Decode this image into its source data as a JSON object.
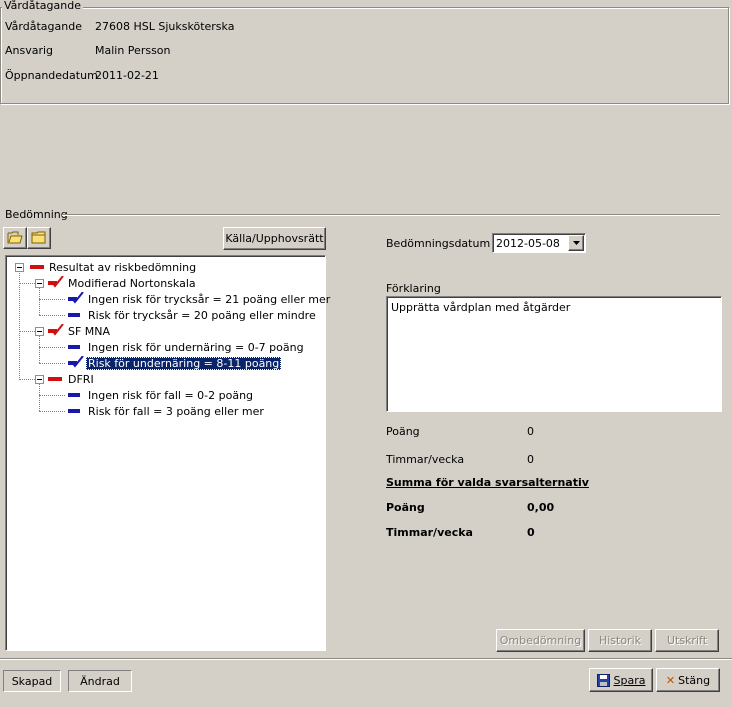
{
  "vardatagande_group": {
    "legend": "Vårdåtagande",
    "rows": [
      {
        "label": "Vårdåtagande",
        "value": "27608 HSL Sjuksköterska"
      },
      {
        "label": "Ansvarig",
        "value": "Malin Persson"
      },
      {
        "label": "Öppnandedatum",
        "value": "2011-02-21"
      }
    ]
  },
  "bedomning": {
    "legend": "Bedömning",
    "toolbar": {
      "open_icon": "folder-open-icon",
      "close_icon": "folder-closed-icon",
      "source_button": "Källa/Upphovsrätt"
    },
    "tree": {
      "root": "Resultat av riskbedömning",
      "groups": [
        {
          "label": "Modifierad Nortonskala",
          "icon": "red-check-icon",
          "items": [
            {
              "label": "Ingen risk för trycksår = 21 poäng eller mer",
              "icon": "blue-check-icon",
              "selected": false
            },
            {
              "label": "Risk för trycksår = 20 poäng eller mindre",
              "icon": "blue-bar-icon",
              "selected": false
            }
          ]
        },
        {
          "label": "SF MNA",
          "icon": "red-check-icon",
          "items": [
            {
              "label": "Ingen risk för undernäring = 0-7 poäng",
              "icon": "blue-bar-icon",
              "selected": false
            },
            {
              "label": "Risk för undernäring = 8-11 poäng",
              "icon": "blue-check-icon",
              "selected": true
            }
          ]
        },
        {
          "label": "DFRI",
          "icon": "red-bar-icon",
          "items": [
            {
              "label": "Ingen risk för fall = 0-2 poäng",
              "icon": "blue-bar-icon",
              "selected": false
            },
            {
              "label": "Risk för fall = 3 poäng eller mer",
              "icon": "blue-bar-icon",
              "selected": false
            }
          ]
        }
      ]
    },
    "date_label": "Bedömningsdatum",
    "date_value": "2012-05-08",
    "forklaring_label": "Förklaring",
    "forklaring_value": "Upprätta vårdplan med åtgärder",
    "poang_label": "Poäng",
    "poang_value": "0",
    "timmar_label": "Timmar/vecka",
    "timmar_value": "0",
    "summa_heading": "Summa för valda svarsalternativ",
    "summa_poang_label": "Poäng",
    "summa_poang_value": "0,00",
    "summa_timmar_label": "Timmar/vecka",
    "summa_timmar_value": "0",
    "buttons": {
      "ombedomning": "Ombedömning",
      "historik": "Historik",
      "utskrift": "Utskrift"
    }
  },
  "footer": {
    "skapad": "Skapad",
    "andrad": "Ändrad",
    "spara": "Spara",
    "stang": "Stäng"
  },
  "colors": {
    "window_bg": "#d4d0c8",
    "selection": "#0a246a",
    "red_mark": "#d01010",
    "blue_mark": "#1818b0"
  }
}
